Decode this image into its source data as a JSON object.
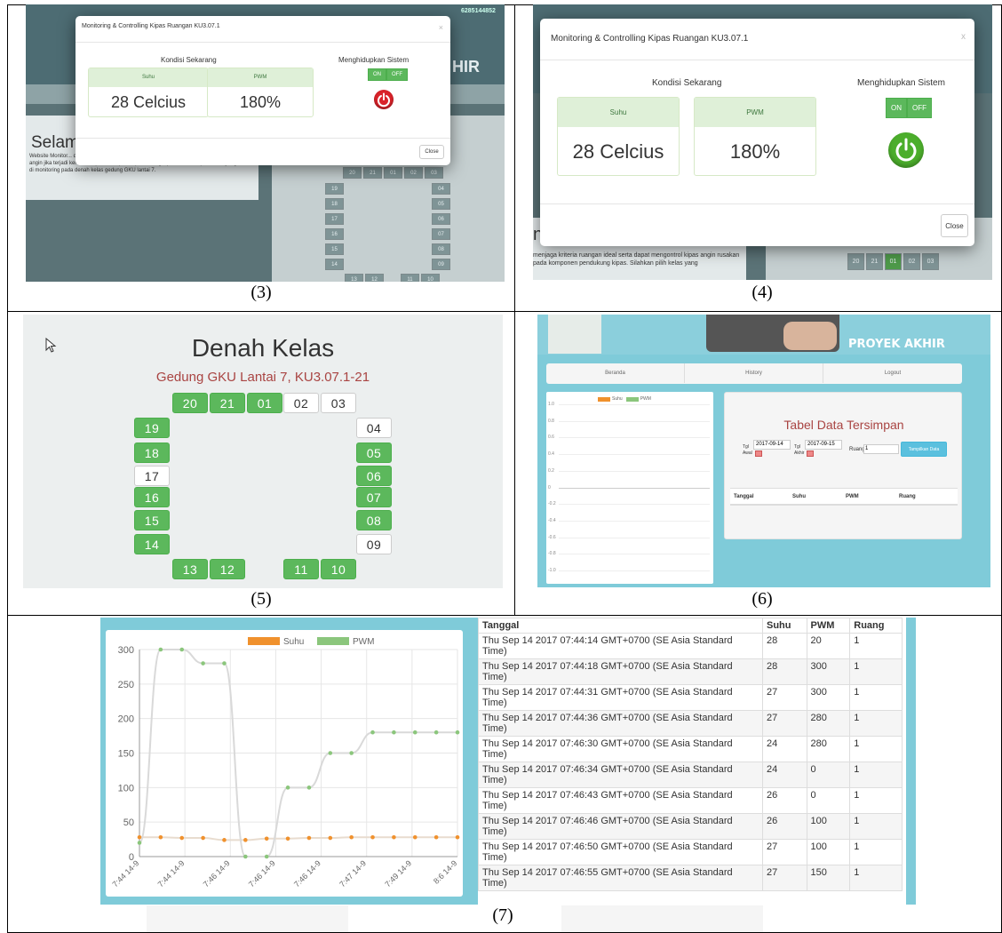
{
  "captions": {
    "c3": "(3)",
    "c4": "(4)",
    "c5": "(5)",
    "c6": "(6)",
    "c7": "(7)"
  },
  "panel3": {
    "modal_title": "Monitoring & Controlling Kipas Ruangan KU3.07.1",
    "close_x": "×",
    "kondisi": "Kondisi Sekarang",
    "suhu_label": "Suhu",
    "suhu_value": "28 Celcius",
    "pwm_label": "PWM",
    "pwm_value": "180%",
    "sistem": "Menghidupkan Sistem",
    "on": "ON",
    "off": "OFF",
    "power_state": "off",
    "close_label": "Close",
    "bg_heading": "Selam",
    "bg_text": "Website Monitor... dengan baik, menjaga kriteria ruangan ideal serta dapat mengontrol kipas angin jika terjadi kerusakan pada komponen pendukung kipas. Silahkan pilih kelas yang akan di monitoring pada denah kelas gedung GKU lantai 7.",
    "bg_phone": "6285144852",
    "bg_proyek": "HIR"
  },
  "panel4": {
    "modal_title": "Monitoring & Controlling Kipas Ruangan KU3.07.1",
    "close_x": "x",
    "kondisi": "Kondisi Sekarang",
    "suhu_label": "Suhu",
    "suhu_value": "28 Celcius",
    "pwm_label": "PWM",
    "pwm_value": "180%",
    "sistem": "Menghidupkan Sistem",
    "on": "ON",
    "off": "OFF",
    "power_state": "on",
    "close_label": "Close",
    "bg_text": "menjaga kriteria ruangan ideal serta dapat mengontrol kipas angin rusakan pada komponen pendukung kipas. Silahkan pilih kelas yang",
    "bg_rooms": [
      "20",
      "21",
      "01",
      "02",
      "03"
    ]
  },
  "panel5": {
    "title": "Denah Kelas",
    "subtitle": "Gedung GKU Lantai 7, KU3.07.1-21",
    "rooms": [
      {
        "id": "20",
        "on": true
      },
      {
        "id": "21",
        "on": true
      },
      {
        "id": "01",
        "on": true
      },
      {
        "id": "02",
        "on": false
      },
      {
        "id": "03",
        "on": false
      },
      {
        "id": "19",
        "on": true
      },
      {
        "id": "18",
        "on": true
      },
      {
        "id": "17",
        "on": false
      },
      {
        "id": "16",
        "on": true
      },
      {
        "id": "15",
        "on": true
      },
      {
        "id": "14",
        "on": true
      },
      {
        "id": "04",
        "on": false
      },
      {
        "id": "05",
        "on": true
      },
      {
        "id": "06",
        "on": true
      },
      {
        "id": "07",
        "on": true
      },
      {
        "id": "08",
        "on": true
      },
      {
        "id": "09",
        "on": false
      },
      {
        "id": "13",
        "on": true
      },
      {
        "id": "12",
        "on": true
      },
      {
        "id": "11",
        "on": true
      },
      {
        "id": "10",
        "on": true
      }
    ]
  },
  "panel6": {
    "banner": "PROYEK AKHIR",
    "nav": [
      "Beranda",
      "History",
      "Logout"
    ],
    "legend": [
      "Suhu",
      "PWM"
    ],
    "yticks": [
      "1.0",
      "0.8",
      "0.6",
      "0.4",
      "0.2",
      "0",
      "-0.2",
      "-0.4",
      "-0.6",
      "-0.8",
      "-1.0"
    ],
    "table_title": "Tabel Data Tersimpan",
    "tgl_awal_label": "Tgl Awal",
    "tgl_awal": "2017-09-14",
    "tgl_akhir_label": "Tgl Akhir",
    "tgl_akhir": "2017-09-15",
    "ruang_label": "Ruang",
    "ruang": "1",
    "btn": "Tampilkan Data",
    "cols": [
      "Tanggal",
      "Suhu",
      "PWM",
      "Ruang"
    ]
  },
  "panel7": {
    "legend": [
      "Suhu",
      "PWM"
    ],
    "cols": [
      "Tanggal",
      "Suhu",
      "PWM",
      "Ruang"
    ],
    "rows": [
      [
        "Thu Sep 14 2017 07:44:14 GMT+0700 (SE Asia Standard Time)",
        "28",
        "20",
        "1"
      ],
      [
        "Thu Sep 14 2017 07:44:18 GMT+0700 (SE Asia Standard Time)",
        "28",
        "300",
        "1"
      ],
      [
        "Thu Sep 14 2017 07:44:31 GMT+0700 (SE Asia Standard Time)",
        "27",
        "300",
        "1"
      ],
      [
        "Thu Sep 14 2017 07:44:36 GMT+0700 (SE Asia Standard Time)",
        "27",
        "280",
        "1"
      ],
      [
        "Thu Sep 14 2017 07:46:30 GMT+0700 (SE Asia Standard Time)",
        "24",
        "280",
        "1"
      ],
      [
        "Thu Sep 14 2017 07:46:34 GMT+0700 (SE Asia Standard Time)",
        "24",
        "0",
        "1"
      ],
      [
        "Thu Sep 14 2017 07:46:43 GMT+0700 (SE Asia Standard Time)",
        "26",
        "0",
        "1"
      ],
      [
        "Thu Sep 14 2017 07:46:46 GMT+0700 (SE Asia Standard Time)",
        "26",
        "100",
        "1"
      ],
      [
        "Thu Sep 14 2017 07:46:50 GMT+0700 (SE Asia Standard Time)",
        "27",
        "100",
        "1"
      ],
      [
        "Thu Sep 14 2017 07:46:55 GMT+0700 (SE Asia Standard Time)",
        "27",
        "150",
        "1"
      ]
    ]
  },
  "chart_data": [
    {
      "type": "line",
      "legend_position": "top",
      "grid": true,
      "ylim": [
        0,
        300
      ],
      "yticks": [
        0,
        50,
        100,
        150,
        200,
        250,
        300
      ],
      "xticklabels": [
        "7:44 14-9",
        "7:44 14-9",
        "7:46 14-9",
        "7:46 14-9",
        "7:46 14-9",
        "7:47 14-9",
        "7:49 14-9",
        "8:6 14-9"
      ],
      "series": [
        {
          "name": "Suhu",
          "color": "#f0912d",
          "values": [
            28,
            28,
            27,
            27,
            24,
            24,
            26,
            26,
            27,
            27,
            28,
            28,
            28,
            28,
            28,
            28
          ]
        },
        {
          "name": "PWM",
          "color": "#8bc67c",
          "values": [
            20,
            300,
            300,
            280,
            280,
            0,
            0,
            100,
            100,
            150,
            150,
            180,
            180,
            180,
            180,
            180
          ]
        }
      ]
    }
  ]
}
